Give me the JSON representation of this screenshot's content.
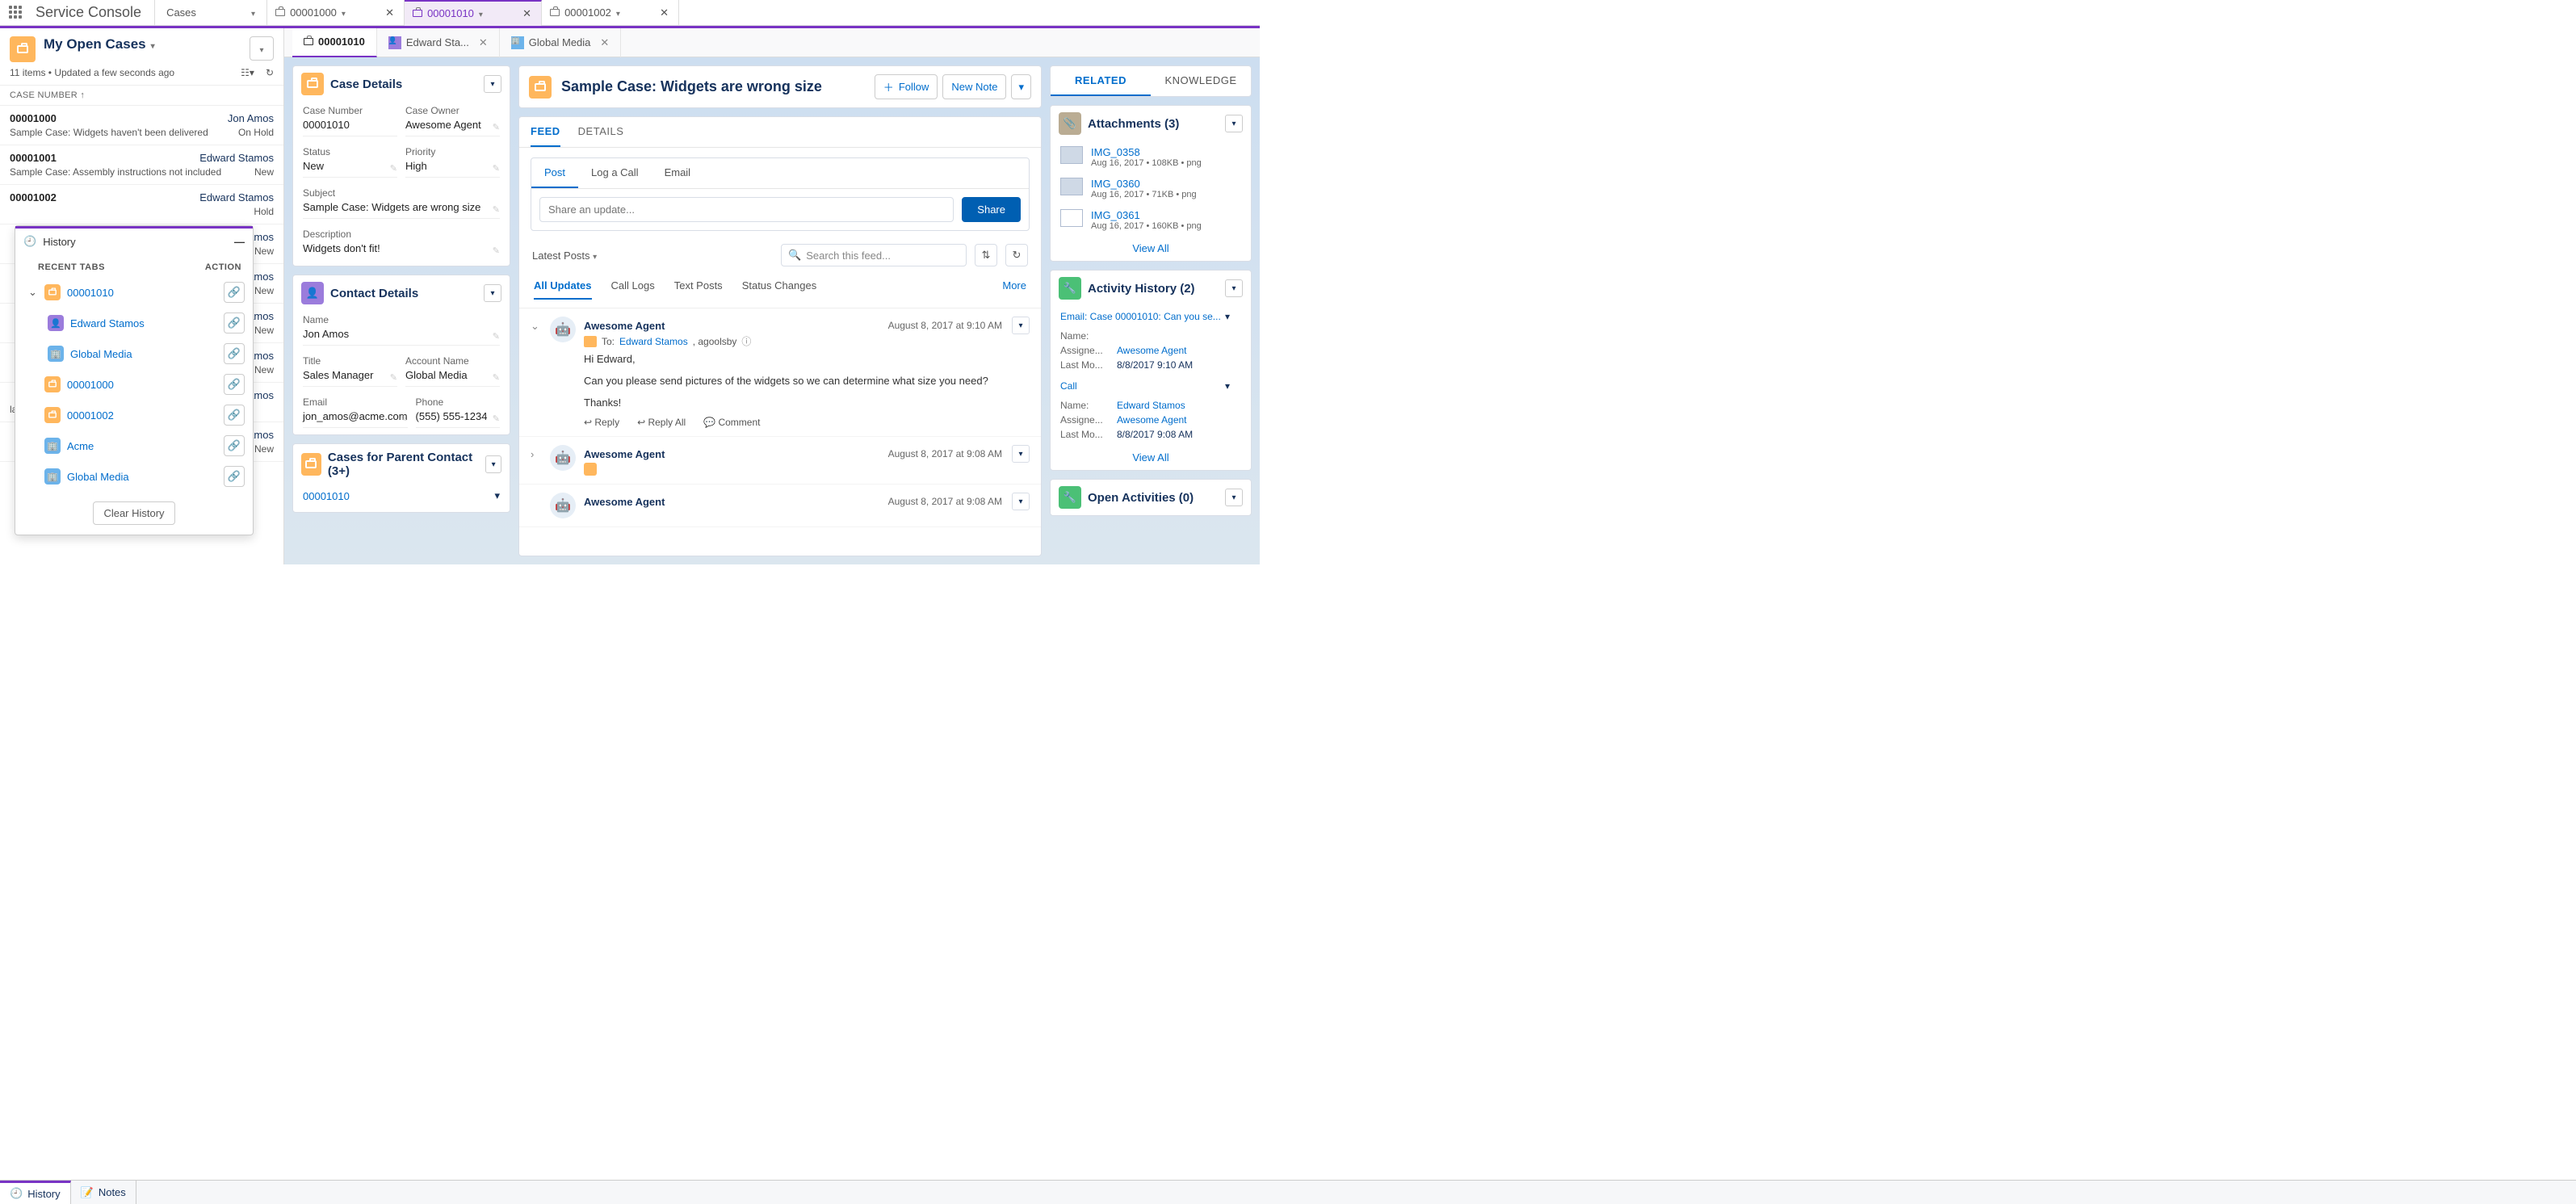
{
  "app": {
    "name": "Service Console"
  },
  "nav": {
    "object": "Cases"
  },
  "workspace_tabs": [
    {
      "id": "00001000",
      "active": false
    },
    {
      "id": "00001010",
      "active": true
    },
    {
      "id": "00001002",
      "active": false
    }
  ],
  "subtabs": [
    {
      "label": "00001010",
      "active": true,
      "closable": false,
      "icon": "case"
    },
    {
      "label": "Edward Sta...",
      "active": false,
      "closable": true,
      "icon": "contact"
    },
    {
      "label": "Global Media",
      "active": false,
      "closable": true,
      "icon": "account"
    }
  ],
  "listview": {
    "title": "My Open Cases",
    "meta": "11 items • Updated a few seconds ago",
    "col_header": "CASE NUMBER",
    "rows": [
      {
        "num": "00001000",
        "contact": "Jon Amos",
        "subject": "Sample Case: Widgets haven't been delivered",
        "status": "On Hold"
      },
      {
        "num": "00001001",
        "contact": "Edward Stamos",
        "subject": "Sample Case: Assembly instructions not included",
        "status": "New"
      },
      {
        "num": "00001002",
        "contact": "Edward Stamos",
        "subject": "",
        "status": "Hold"
      },
      {
        "num": "",
        "contact": "Amos",
        "subject": "",
        "status": "New"
      },
      {
        "num": "",
        "contact": "Amos",
        "subject": "",
        "status": "New"
      },
      {
        "num": "",
        "contact": "amos",
        "subject": "",
        "status": "New"
      },
      {
        "num": "",
        "contact": "Amos",
        "subject": "",
        "status": "New"
      },
      {
        "num": "",
        "contact": "Amos",
        "subject": "lated",
        "status": ""
      },
      {
        "num": "",
        "contact": "Amos",
        "subject": "",
        "status": "New"
      }
    ]
  },
  "history": {
    "title": "History",
    "recent_label": "RECENT TABS",
    "action_label": "ACTION",
    "clear": "Clear History",
    "items": [
      {
        "label": "00001010",
        "type": "case",
        "indent": 0,
        "expandable": true
      },
      {
        "label": "Edward Stamos",
        "type": "contact",
        "indent": 1,
        "expandable": false
      },
      {
        "label": "Global Media",
        "type": "account",
        "indent": 1,
        "expandable": false
      },
      {
        "label": "00001000",
        "type": "case",
        "indent": 0,
        "expandable": false
      },
      {
        "label": "00001002",
        "type": "case",
        "indent": 0,
        "expandable": false
      },
      {
        "label": "Acme",
        "type": "account",
        "indent": 0,
        "expandable": false
      },
      {
        "label": "Global Media",
        "type": "account",
        "indent": 0,
        "expandable": false
      }
    ]
  },
  "case_details": {
    "title": "Case Details",
    "case_number_label": "Case Number",
    "case_number": "00001010",
    "owner_label": "Case Owner",
    "owner": "Awesome Agent",
    "status_label": "Status",
    "status": "New",
    "priority_label": "Priority",
    "priority": "High",
    "subject_label": "Subject",
    "subject": "Sample Case: Widgets are wrong size",
    "description_label": "Description",
    "description": "Widgets don't fit!"
  },
  "contact_details": {
    "title": "Contact Details",
    "name_label": "Name",
    "name": "Jon Amos",
    "title_label": "Title",
    "title_value": "Sales Manager",
    "account_label": "Account Name",
    "account": "Global Media",
    "email_label": "Email",
    "email": "jon_amos@acme.com",
    "phone_label": "Phone",
    "phone": "(555) 555-1234"
  },
  "cases_parent": {
    "title": "Cases for Parent Contact (3+)",
    "first": "00001010"
  },
  "highlights": {
    "title": "Sample Case: Widgets are wrong size",
    "follow": "Follow",
    "new_note": "New Note"
  },
  "record_tabs": {
    "feed": "FEED",
    "details": "DETAILS"
  },
  "publisher": {
    "tabs": {
      "post": "Post",
      "log": "Log a Call",
      "email": "Email"
    },
    "placeholder": "Share an update...",
    "share": "Share"
  },
  "feed": {
    "sort": "Latest Posts",
    "search_placeholder": "Search this feed...",
    "filters": {
      "all": "All Updates",
      "calls": "Call Logs",
      "text": "Text Posts",
      "status": "Status Changes",
      "more": "More"
    },
    "items": [
      {
        "author": "Awesome Agent",
        "time": "August 8, 2017 at 9:10 AM",
        "to_label": "To:",
        "to_name": "Edward Stamos",
        "to_extra": ", agoolsby",
        "body1": "Hi Edward,",
        "body2": "Can you please send pictures of the widgets so we can determine what size you need?",
        "body3": "Thanks!",
        "actions": {
          "reply": "Reply",
          "reply_all": "Reply All",
          "comment": "Comment"
        },
        "expanded": true
      },
      {
        "author": "Awesome Agent",
        "time": "August 8, 2017 at 9:08 AM",
        "expanded": false,
        "locked": true
      },
      {
        "author": "Awesome Agent",
        "time": "August 8, 2017 at 9:08 AM",
        "expanded": false
      }
    ]
  },
  "related": {
    "tabs": {
      "related": "RELATED",
      "knowledge": "KNOWLEDGE"
    },
    "attachments": {
      "title": "Attachments (3)",
      "items": [
        {
          "name": "IMG_0358",
          "meta": "Aug 16, 2017 • 108KB • png"
        },
        {
          "name": "IMG_0360",
          "meta": "Aug 16, 2017 • 71KB • png"
        },
        {
          "name": "IMG_0361",
          "meta": "Aug 16, 2017 • 160KB • png"
        }
      ],
      "viewall": "View All"
    },
    "activity_history": {
      "title": "Activity History (2)",
      "items": [
        {
          "subject": "Email: Case 00001010: Can you se...",
          "name_k": "Name:",
          "name_v": "",
          "assign_k": "Assigne...",
          "assign_v": "Awesome Agent",
          "mod_k": "Last Mo...",
          "mod_v": "8/8/2017 9:10 AM"
        },
        {
          "subject": "Call",
          "name_k": "Name:",
          "name_v": "Edward Stamos",
          "assign_k": "Assigne...",
          "assign_v": "Awesome Agent",
          "mod_k": "Last Mo...",
          "mod_v": "8/8/2017 9:08 AM"
        }
      ],
      "viewall": "View All"
    },
    "open_activities": {
      "title": "Open Activities (0)"
    }
  },
  "utility": {
    "history": "History",
    "notes": "Notes"
  }
}
